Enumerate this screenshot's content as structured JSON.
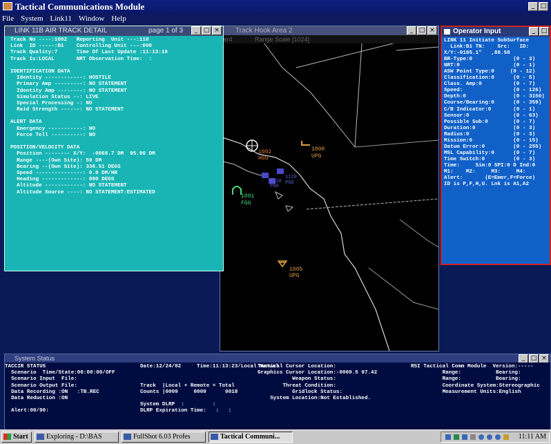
{
  "app": {
    "title": "Tactical Communications Module"
  },
  "menu": [
    "File",
    "System",
    "Link11",
    "Window",
    "Help"
  ],
  "map": {
    "title": "Track Hook Area 2",
    "sub_left": "ter4",
    "range_scale": "Range Scale [1024]",
    "tracks": [
      {
        "id": "1002",
        "code": "HGG",
        "color": "#e08040"
      },
      {
        "id": "1000",
        "code": "UPG",
        "color": "#e0a040"
      },
      {
        "id": "1001",
        "code": "FGG",
        "color": "#40e080"
      },
      {
        "id": "1005",
        "code": "UPG",
        "color": "#e0a040"
      },
      {
        "id": "1120",
        "code": "",
        "color": "#6060e0"
      },
      {
        "id": "1110",
        "code": "",
        "color": "#6060e0"
      },
      {
        "id": "PGG",
        "code": "",
        "color": "#6060e0"
      },
      {
        "id": "PGG",
        "code": "",
        "color": "#6060e0"
      }
    ]
  },
  "detail": {
    "title": "LINK 11B AIR TRACK DETAIL",
    "page": "page 1 of 3",
    "lines": [
      "Track No ----:1002   Reporting  Unit ---:110",
      "Link  ID -----:B1    Controlling Unit ---:000",
      "Track Quality:7      Time Of Last Update :11:13:19",
      "Track Is:LOCAL       NRT Observation Time:  :",
      "",
      "IDENTIFICATION DATA",
      "  Identity ------------: HOSTILE",
      "  Primary Amp ---------: NO STATEMENT",
      "  Identity Amp --------: NO STATEMENT",
      "  Simulation Status --: LIVE",
      "  Special Processing -: NO",
      "  Raid Strength ------: NO STATEMENT",
      "",
      "ALERT DATA",
      "  Emergency -----------: NO",
      "  Force Tell ----------: NO",
      "",
      "POSITION/VELOCITY DATA",
      "  Position -------- X/Y:  -0068.7 DM  95.90 DM",
      "  Range ----(Own Site): 59 DM",
      "  Bearing --(Own Site): 336.51 DEGS",
      "  Speed ---------------: 0.0 DM/HR",
      "  Heading -------------: 000 DEGS",
      "  Altitude ------------: NO STATEMENT",
      "  Altitude Source ----: NO STATEMENT:ESTIMATED"
    ]
  },
  "operator": {
    "title": "Operator Input",
    "lines": [
      "LINK 11 Initiate SubSurface",
      "  Link:B1 TN:    Src:   ID:",
      "X/Y:-0185.1\"   ,88.58",
      "BR-Type:0             (0 - 3)",
      "NRT:0                 (0 - 1)",
      "ASW Point Type:0     (0 - 12)",
      "Classification:0      (0 - 5)",
      "Class. Amp:0          (0 - 7)",
      "Speed:                (0 - 126)",
      "Depth:0               (0 - 3150)",
      "Course/Bearing:0      (0 - 359)",
      "C/B Indicator:0       (0 - 1)",
      "Sensor:0              (0 - 63)",
      "Possible Sub:0        (0 - 7)",
      "Duration:0            (0 - 3)",
      "Radius:0              (0 - 3)",
      "Mission:0             (0 - 15)",
      "Datum Error:0         (0 - 255)",
      "MSL Capability:0      (0 - 7)",
      "Time Switch:0         (0 - 3)",
      "Time:     Sim:0 SPI:0 D Ind:0",
      "M1:    M2:     M3:     M4:",
      "Alert:       (E=Emer,F=Force)",
      "ID is P,F,H,U. Lnk is A1,A2"
    ]
  },
  "status": {
    "title": "System Status",
    "col1": [
      "TACCIR STATUS",
      "  Scenario  Time/State:00:00:00/OFF",
      "  Scenario Input  File:",
      "  Scenario Output File:",
      "  Data Recording :ON   :TB.REC",
      "  Data Reduction :ON",
      "",
      "  Alert:00/00:"
    ],
    "col2": [
      "Date:12/24/02     Time:11:13:23/Local Manual",
      "",
      "",
      "Track  |Local + Remote = Total",
      "Counts |0009     0009      0018",
      "",
      "System DLRP  :         :",
      "DLRP Expiration Time:   :   :"
    ],
    "col3": [
      "Tactical Cursor Location:",
      "Graphics Cursor Location:-0069.5 97.42",
      "           Weapon Status:",
      "        Threat Condition:",
      "           Gridlock Status:",
      "    System Location:Not Established."
    ],
    "col4": [
      "RSI Tactical Comm Module  Version:-----",
      "          Range:           Bearing:",
      "          Range:           Bearing:",
      "          Coordinate System:Stereographic",
      "          Measurement Units:English"
    ]
  },
  "taskbar": {
    "start": "Start",
    "items": [
      "Exploring - D:\\BAS",
      "FullShot 6.03 Profes",
      "Tactical Communi..."
    ],
    "clock": "11:11 AM"
  }
}
